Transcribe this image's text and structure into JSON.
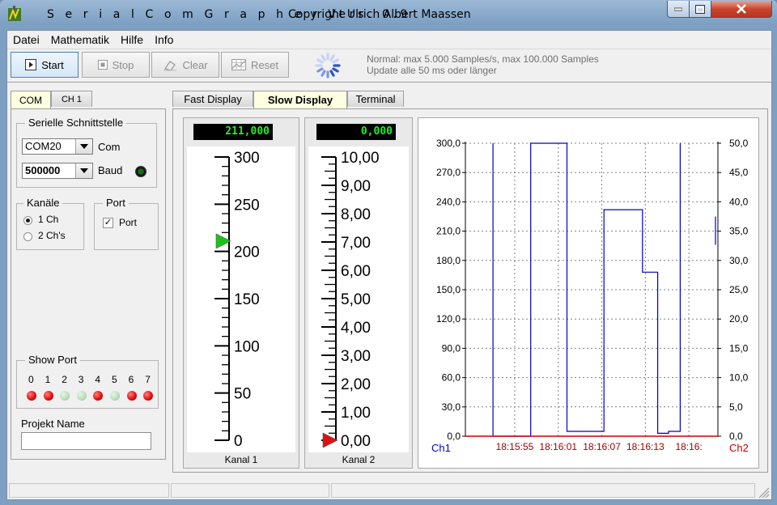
{
  "window": {
    "title": "S e r i a l C o m G r a p h e r  Vers. 0.9",
    "copyright": "Copyright Ulrich Albert Maassen"
  },
  "menu": [
    "Datei",
    "Mathematik",
    "Hilfe",
    "Info"
  ],
  "toolbar": {
    "start": "Start",
    "stop": "Stop",
    "clear": "Clear",
    "reset": "Reset",
    "info_line1": "Normal: max 5.000 Samples/s, max 100.000 Samples",
    "info_line2": "Update alle 50 ms oder länger"
  },
  "left_tabs": [
    "COM",
    "CH 1"
  ],
  "serial": {
    "group_label": "Serielle Schnittstelle",
    "port_value": "COM20",
    "port_label": "Com",
    "baud_value": "500000",
    "baud_label": "Baud"
  },
  "channels": {
    "group_label": "Kanäle",
    "option1": "1 Ch",
    "option2": "2 Ch's",
    "selected": 1
  },
  "port": {
    "group_label": "Port",
    "checkbox_label": "Port",
    "checked": true
  },
  "show_port": {
    "group_label": "Show Port",
    "bits": [
      "0",
      "1",
      "2",
      "3",
      "4",
      "5",
      "6",
      "7"
    ],
    "states": [
      true,
      true,
      false,
      false,
      true,
      false,
      true,
      true
    ],
    "on_color": "#e81010",
    "off_color": "#b9dcb9"
  },
  "project": {
    "label": "Projekt Name",
    "value": ""
  },
  "display_tabs": [
    "Fast Display",
    "Slow Display",
    "Terminal"
  ],
  "gauge1": {
    "readout": "211,000",
    "value": 211,
    "min": 0,
    "max": 300,
    "labels": [
      "300",
      "250",
      "200",
      "150",
      "100",
      "50",
      "0"
    ],
    "caption": "Kanal 1",
    "marker_color": "#19c419"
  },
  "gauge2": {
    "readout": "0,000",
    "value": 0,
    "min": 0,
    "max": 10,
    "labels": [
      "10,00",
      "9,00",
      "8,00",
      "7,00",
      "6,00",
      "5,00",
      "4,00",
      "3,00",
      "2,00",
      "1,00",
      "0,00"
    ],
    "caption": "Kanal 2",
    "marker_color": "#e01010"
  },
  "chart_data": {
    "type": "line",
    "y_left": {
      "label": "Ch1",
      "ticks": [
        "300,0",
        "270,0",
        "240,0",
        "210,0",
        "180,0",
        "150,0",
        "120,0",
        "90,0",
        "60,0",
        "30,0",
        "0,0"
      ],
      "range": [
        0,
        300
      ]
    },
    "y_right": {
      "label": "Ch2",
      "ticks": [
        "50,0",
        "45,0",
        "40,0",
        "35,0",
        "30,0",
        "25,0",
        "20,0",
        "15,0",
        "10,0",
        "5,0",
        "0,0"
      ],
      "range": [
        0,
        50
      ]
    },
    "x_ticks": [
      "18:15:55",
      "18:16:01",
      "18:16:07",
      "18:16:13",
      "18:16:"
    ],
    "series": [
      {
        "name": "Ch1",
        "color": "#0000c8",
        "points": [
          [
            0,
            300
          ],
          [
            0,
            0
          ],
          [
            5.2,
            0
          ],
          [
            5.2,
            300
          ],
          [
            10.2,
            300
          ],
          [
            10.2,
            5
          ],
          [
            15.3,
            5
          ],
          [
            15.3,
            232
          ],
          [
            20.6,
            232
          ],
          [
            20.6,
            168
          ],
          [
            22.7,
            168
          ],
          [
            22.7,
            3
          ],
          [
            24.2,
            3
          ],
          [
            24.2,
            5
          ],
          [
            25.8,
            5
          ],
          [
            25.8,
            300
          ]
        ]
      },
      {
        "name": "Ch2",
        "color": "#c80000",
        "points": [
          [
            -3.8,
            0
          ],
          [
            31.0,
            0
          ]
        ]
      }
    ],
    "grid": true
  }
}
